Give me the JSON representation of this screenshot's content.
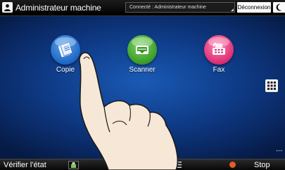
{
  "topbar": {
    "user_icon": "user-icon",
    "title": "Administrateur machine",
    "connection": "Connecté : Administrateur machine",
    "logout_label": "Déconnexion",
    "sleep_icon": "moon-icon"
  },
  "apps": [
    {
      "label": "Copie",
      "icon": "copy-icon",
      "color": "#2f7fd8"
    },
    {
      "label": "Scanner",
      "icon": "scanner-icon",
      "color": "#4aad33"
    },
    {
      "label": "Fax",
      "icon": "fax-icon",
      "color": "#e83d80"
    }
  ],
  "grid_button_icon": "app-grid-icon",
  "bottombar": {
    "check_status_label": "Vérifier l'état",
    "status_icon": "machine-status-icon",
    "menu_icon": "menu-icon",
    "stop_label": "Stop",
    "stop_color": "#e85a2a"
  }
}
